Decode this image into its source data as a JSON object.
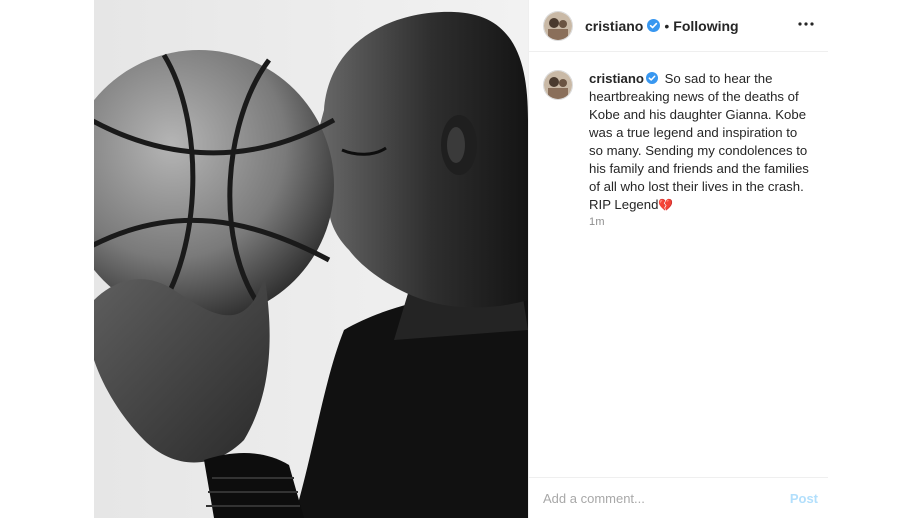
{
  "post": {
    "photo_alt": "black-and-white portrait",
    "author": {
      "username": "cristiano",
      "verified": true,
      "follow_status": "Following"
    },
    "header": {
      "separator": "•",
      "more_icon": "more-horizontal-icon"
    },
    "caption": {
      "username": "cristiano",
      "text": "So sad to hear the heartbreaking news of the deaths of Kobe and his daughter Gianna. Kobe was a true legend and inspiration to so many. Sending my condolences to his family and friends and the families of all who lost their lives in the crash. RIP Legend",
      "emoji": "💔",
      "time": "1m"
    },
    "comment": {
      "placeholder": "Add a comment...",
      "post_label": "Post"
    },
    "colors": {
      "verified": "#3897f0",
      "post_button_disabled": "#b2dffc",
      "border": "#efefef"
    }
  }
}
